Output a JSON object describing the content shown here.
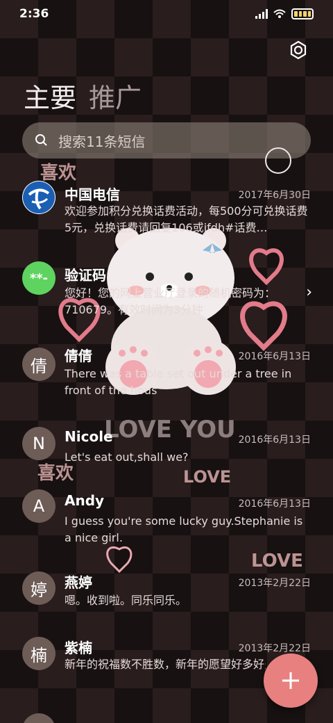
{
  "status": {
    "time": "2:36"
  },
  "tabs": {
    "primary": "主要",
    "promo": "推广"
  },
  "search": {
    "placeholder": "搜索11条短信"
  },
  "messages": [
    {
      "name": "中国电信",
      "date": "2017年6月30日",
      "preview": "欢迎参加积分兑换话费活动，每500分可兑换话费5元，兑换话费请回复106或jfdh#话费…",
      "avatar": ""
    },
    {
      "name": "验证码",
      "date": "",
      "preview": "您好！您的网上营业厅登录的随机密码为：710679。有效时间为3分钟",
      "avatar": "**-"
    },
    {
      "name": "倩倩",
      "date": "2016年6月13日",
      "preview": "There was a table set out under a tree in front of the hous",
      "avatar": "倩"
    },
    {
      "name": "Nicole",
      "date": "2016年6月13日",
      "preview": "Let's eat out,shall we?",
      "avatar": "N"
    },
    {
      "name": "Andy",
      "date": "2016年6月13日",
      "preview": "I guess you're some lucky guy.Stephanie is a nice girl.",
      "avatar": "A"
    },
    {
      "name": "燕婷",
      "date": "2013年2月22日",
      "preview": "嗯。收到啦。同乐同乐。",
      "avatar": "婷"
    },
    {
      "name": "紫楠",
      "date": "2013年2月22日",
      "preview": "新年的祝福数不胜数，新年的愿望好多好多，新年的问候依旧美好，在这个温馨的时刻…",
      "avatar": "楠"
    }
  ],
  "decor": {
    "love_big": "LOVE YOU",
    "love_small": "LOVE",
    "xihuan": "喜欢"
  },
  "colors": {
    "accent": "#e88080",
    "telecom_blue": "#1a5fb4",
    "verify_green": "#5fd35f"
  },
  "icons": {
    "settings": "settings-icon",
    "search": "search-icon",
    "add": "plus-icon",
    "chevron": "chevron-right-icon"
  }
}
